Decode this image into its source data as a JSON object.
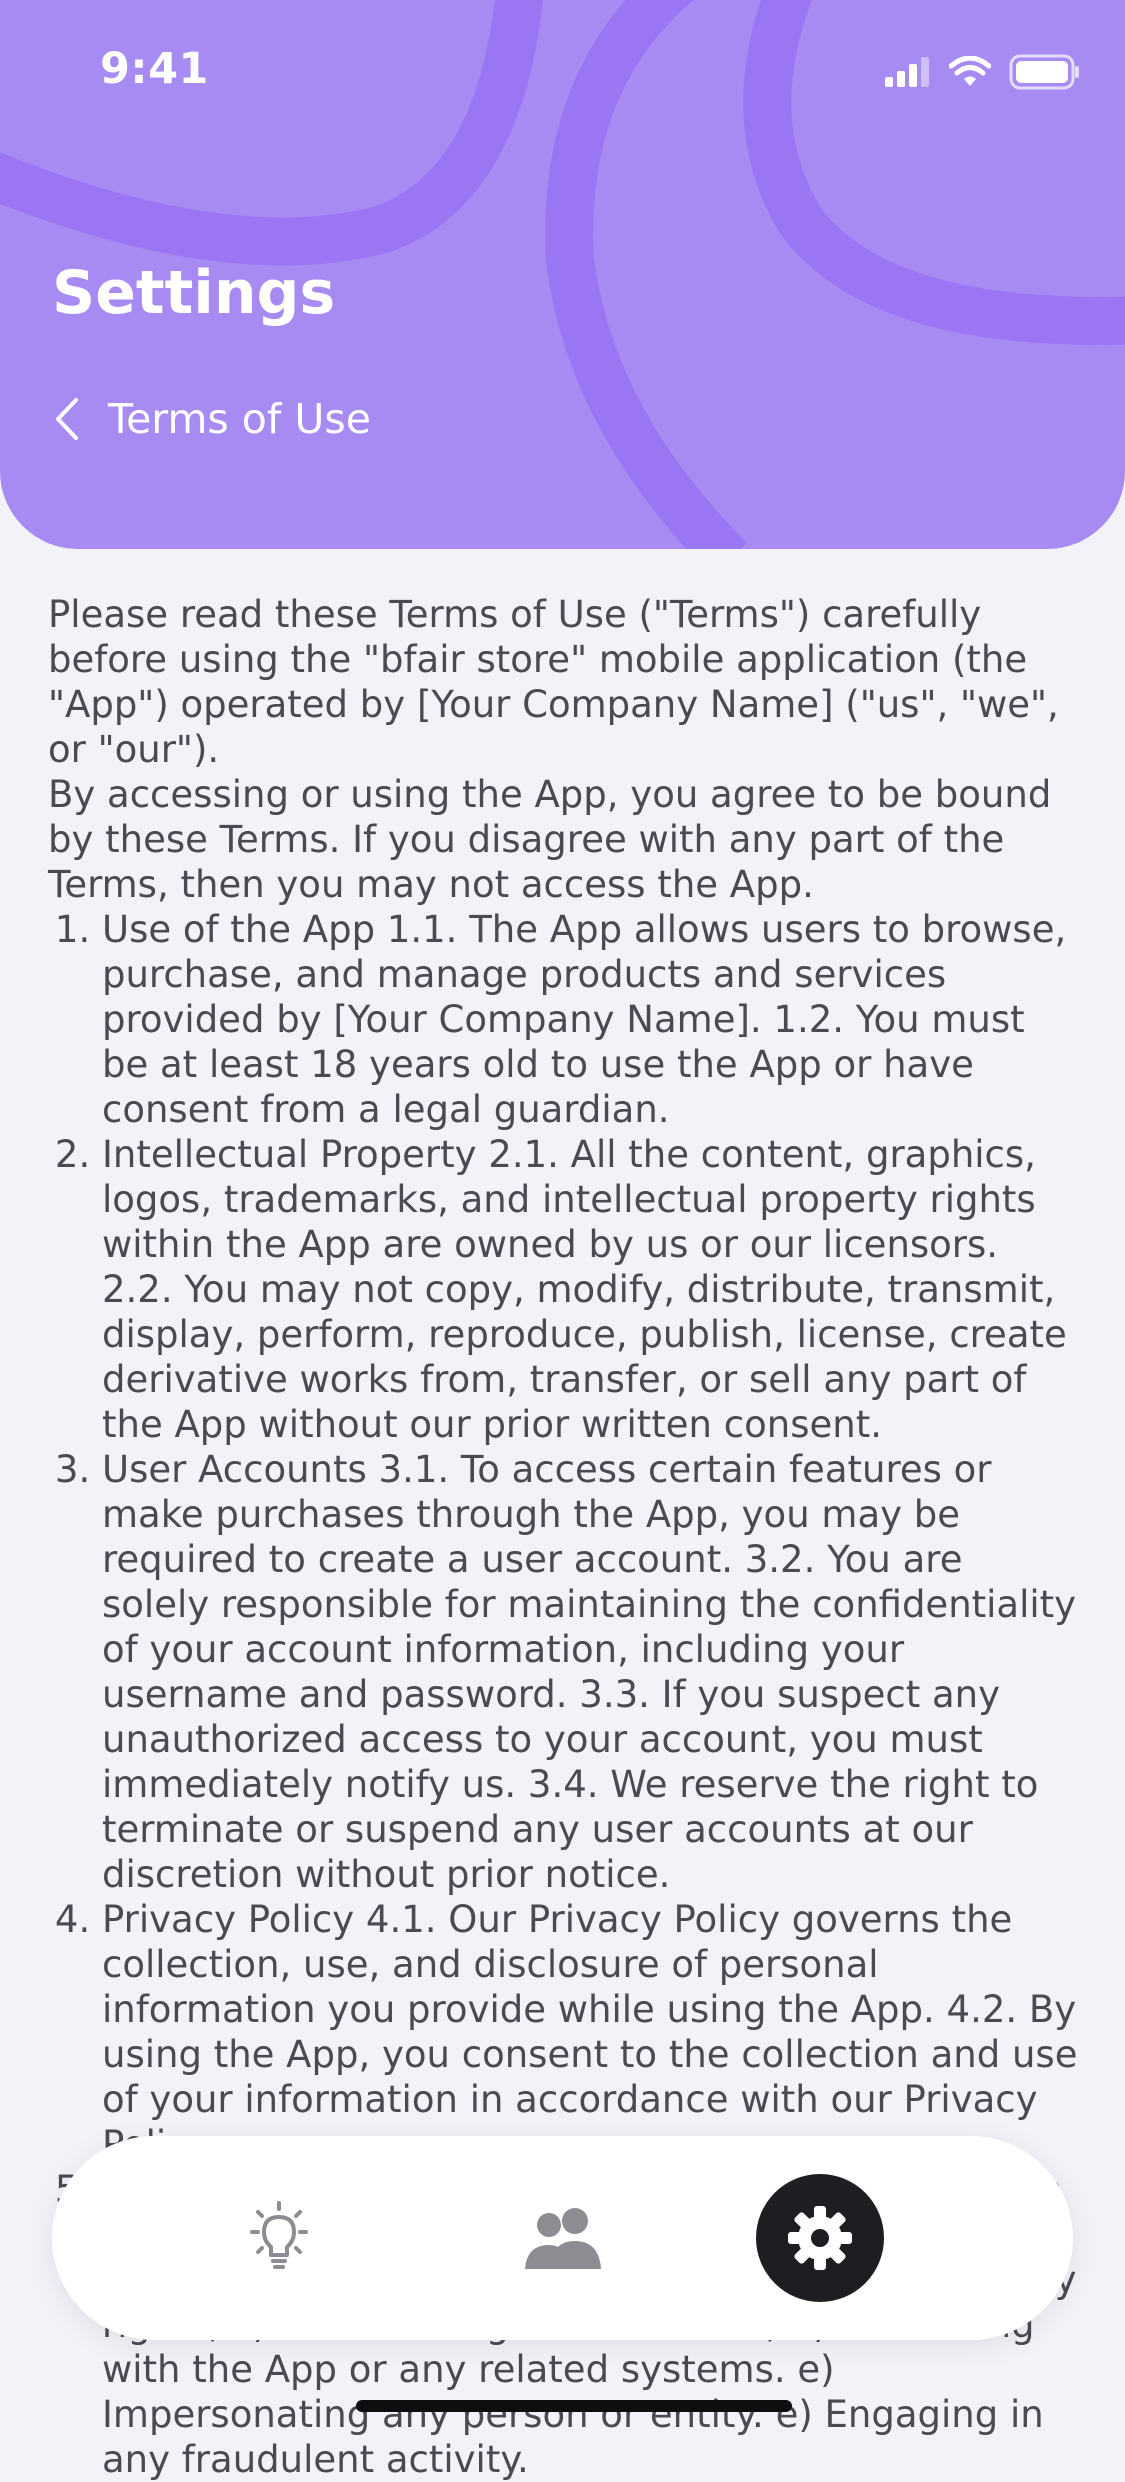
{
  "status_bar": {
    "time": "9:41"
  },
  "header": {
    "title": "Settings",
    "back_label": "Terms of Use"
  },
  "content": {
    "intro": [
      "Please read these Terms of Use (\"Terms\") carefully before using the \"bfair store\" mobile application (the \"App\") operated by [Your Company Name] (\"us\", \"we\", or \"our\").",
      "By accessing or using the App, you agree to be bound by these Terms. If you disagree with any part of the Terms, then you may not access the App."
    ],
    "sections": [
      "Use of the App 1.1. The App allows users to browse, purchase, and manage products and services provided by [Your Company Name]. 1.2. You must be at least 18 years old to use the App or have consent from a legal guardian.",
      "Intellectual Property 2.1. All the content, graphics, logos, trademarks, and intellectual property rights within the App are owned by us or our licensors. 2.2. You may not copy, modify, distribute, transmit, display, perform, reproduce, publish, license, create derivative works from, transfer, or sell any part of the App without our prior written consent.",
      "User Accounts 3.1. To access certain features or make purchases through the App, you may be required to create a user account. 3.2. You are solely responsible for maintaining the confidentiality of your account information, including your username and password. 3.3. If you suspect any unauthorized access to your account, you must immediately notify us. 3.4. We reserve the right to terminate or suspend any user accounts at our discretion without prior notice.",
      "Privacy Policy 4.1. Our Privacy Policy governs the collection, use, and disclosure of personal information you provide while using the App. 4.2. By using the App, you consent to the collection and use of your information in accordance with our Privacy Policy.",
      "Prohibited Activities 5.1. You agree not to engage in any of the following prohibited activities: a) Violating any laws; b) Infringing intellectual property rights; c) Transmitting harmful code; d) Interfering with the App or any related systems. e) Impersonating any person or entity. e) Engaging in any fraudulent activity."
    ]
  },
  "bottom_nav": {
    "items": [
      {
        "icon": "lightbulb-icon",
        "active": false
      },
      {
        "icon": "users-icon",
        "active": false
      },
      {
        "icon": "gear-icon",
        "active": true
      }
    ]
  },
  "colors": {
    "header_bg": "#a78bf3",
    "header_deco": "#9a76f5",
    "text": "#4a4a52",
    "background": "#f3f2f8",
    "active_nav": "#1e1e22"
  }
}
